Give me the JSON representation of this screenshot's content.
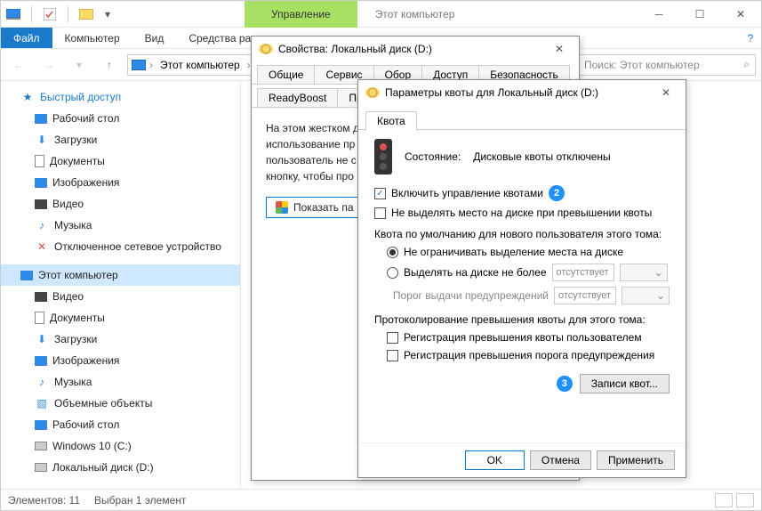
{
  "titlebar": {
    "ribbon_tab": "Управление",
    "window_title": "Этот компьютер"
  },
  "menubar": {
    "file": "Файл",
    "computer": "Компьютер",
    "view": "Вид",
    "tools": "Средства ра"
  },
  "address": {
    "crumb": "Этот компьютер"
  },
  "search": {
    "placeholder": "Поиск: Этот компьютер"
  },
  "sidebar": {
    "quick": "Быстрый доступ",
    "q_items": [
      "Рабочий стол",
      "Загрузки",
      "Документы",
      "Изображения",
      "Видео",
      "Музыка",
      "Отключенное сетевое устройство"
    ],
    "this_pc": "Этот компьютер",
    "pc_items": [
      "Видео",
      "Документы",
      "Загрузки",
      "Изображения",
      "Музыка",
      "Объемные объекты",
      "Рабочий стол",
      "Windows 10  (C:)",
      "Локальный диск  (D:)"
    ]
  },
  "statusbar": {
    "elements": "Элементов: 11",
    "selected": "Выбран 1 элемент"
  },
  "props": {
    "title": "Свойства: Локальный диск (D:)",
    "tabs_row1": [
      "Общие",
      "Сервис",
      "Обор",
      "Доступ",
      "Безопасность"
    ],
    "tabs_row2": [
      "ReadyBoost",
      "Пре"
    ],
    "text": "На этом жестком д\nиспользование пр\nпользователь не с\nкнопку, чтобы про",
    "show_btn": "Показать па"
  },
  "quota": {
    "title": "Параметры квоты для Локальный диск (D:)",
    "tab": "Квота",
    "status_label": "Состояние:",
    "status_value": "Дисковые квоты отключены",
    "enable": "Включить управление квотами",
    "deny": "Не выделять место на диске при превышении квоты",
    "default_section": "Квота по умолчанию для нового пользователя этого тома:",
    "no_limit": "Не ограничивать выделение места на диске",
    "limit_to": "Выделять на диске не более",
    "warn_label": "Порог выдачи предупреждений",
    "absent": "отсутствует",
    "log_section": "Протоколирование превышения квоты для этого тома:",
    "log_quota": "Регистрация превышения квоты пользователем",
    "log_warn": "Регистрация превышения порога предупреждения",
    "records_btn": "Записи квот...",
    "ok": "OK",
    "cancel": "Отмена",
    "apply": "Применить",
    "badge2": "2",
    "badge3": "3"
  }
}
